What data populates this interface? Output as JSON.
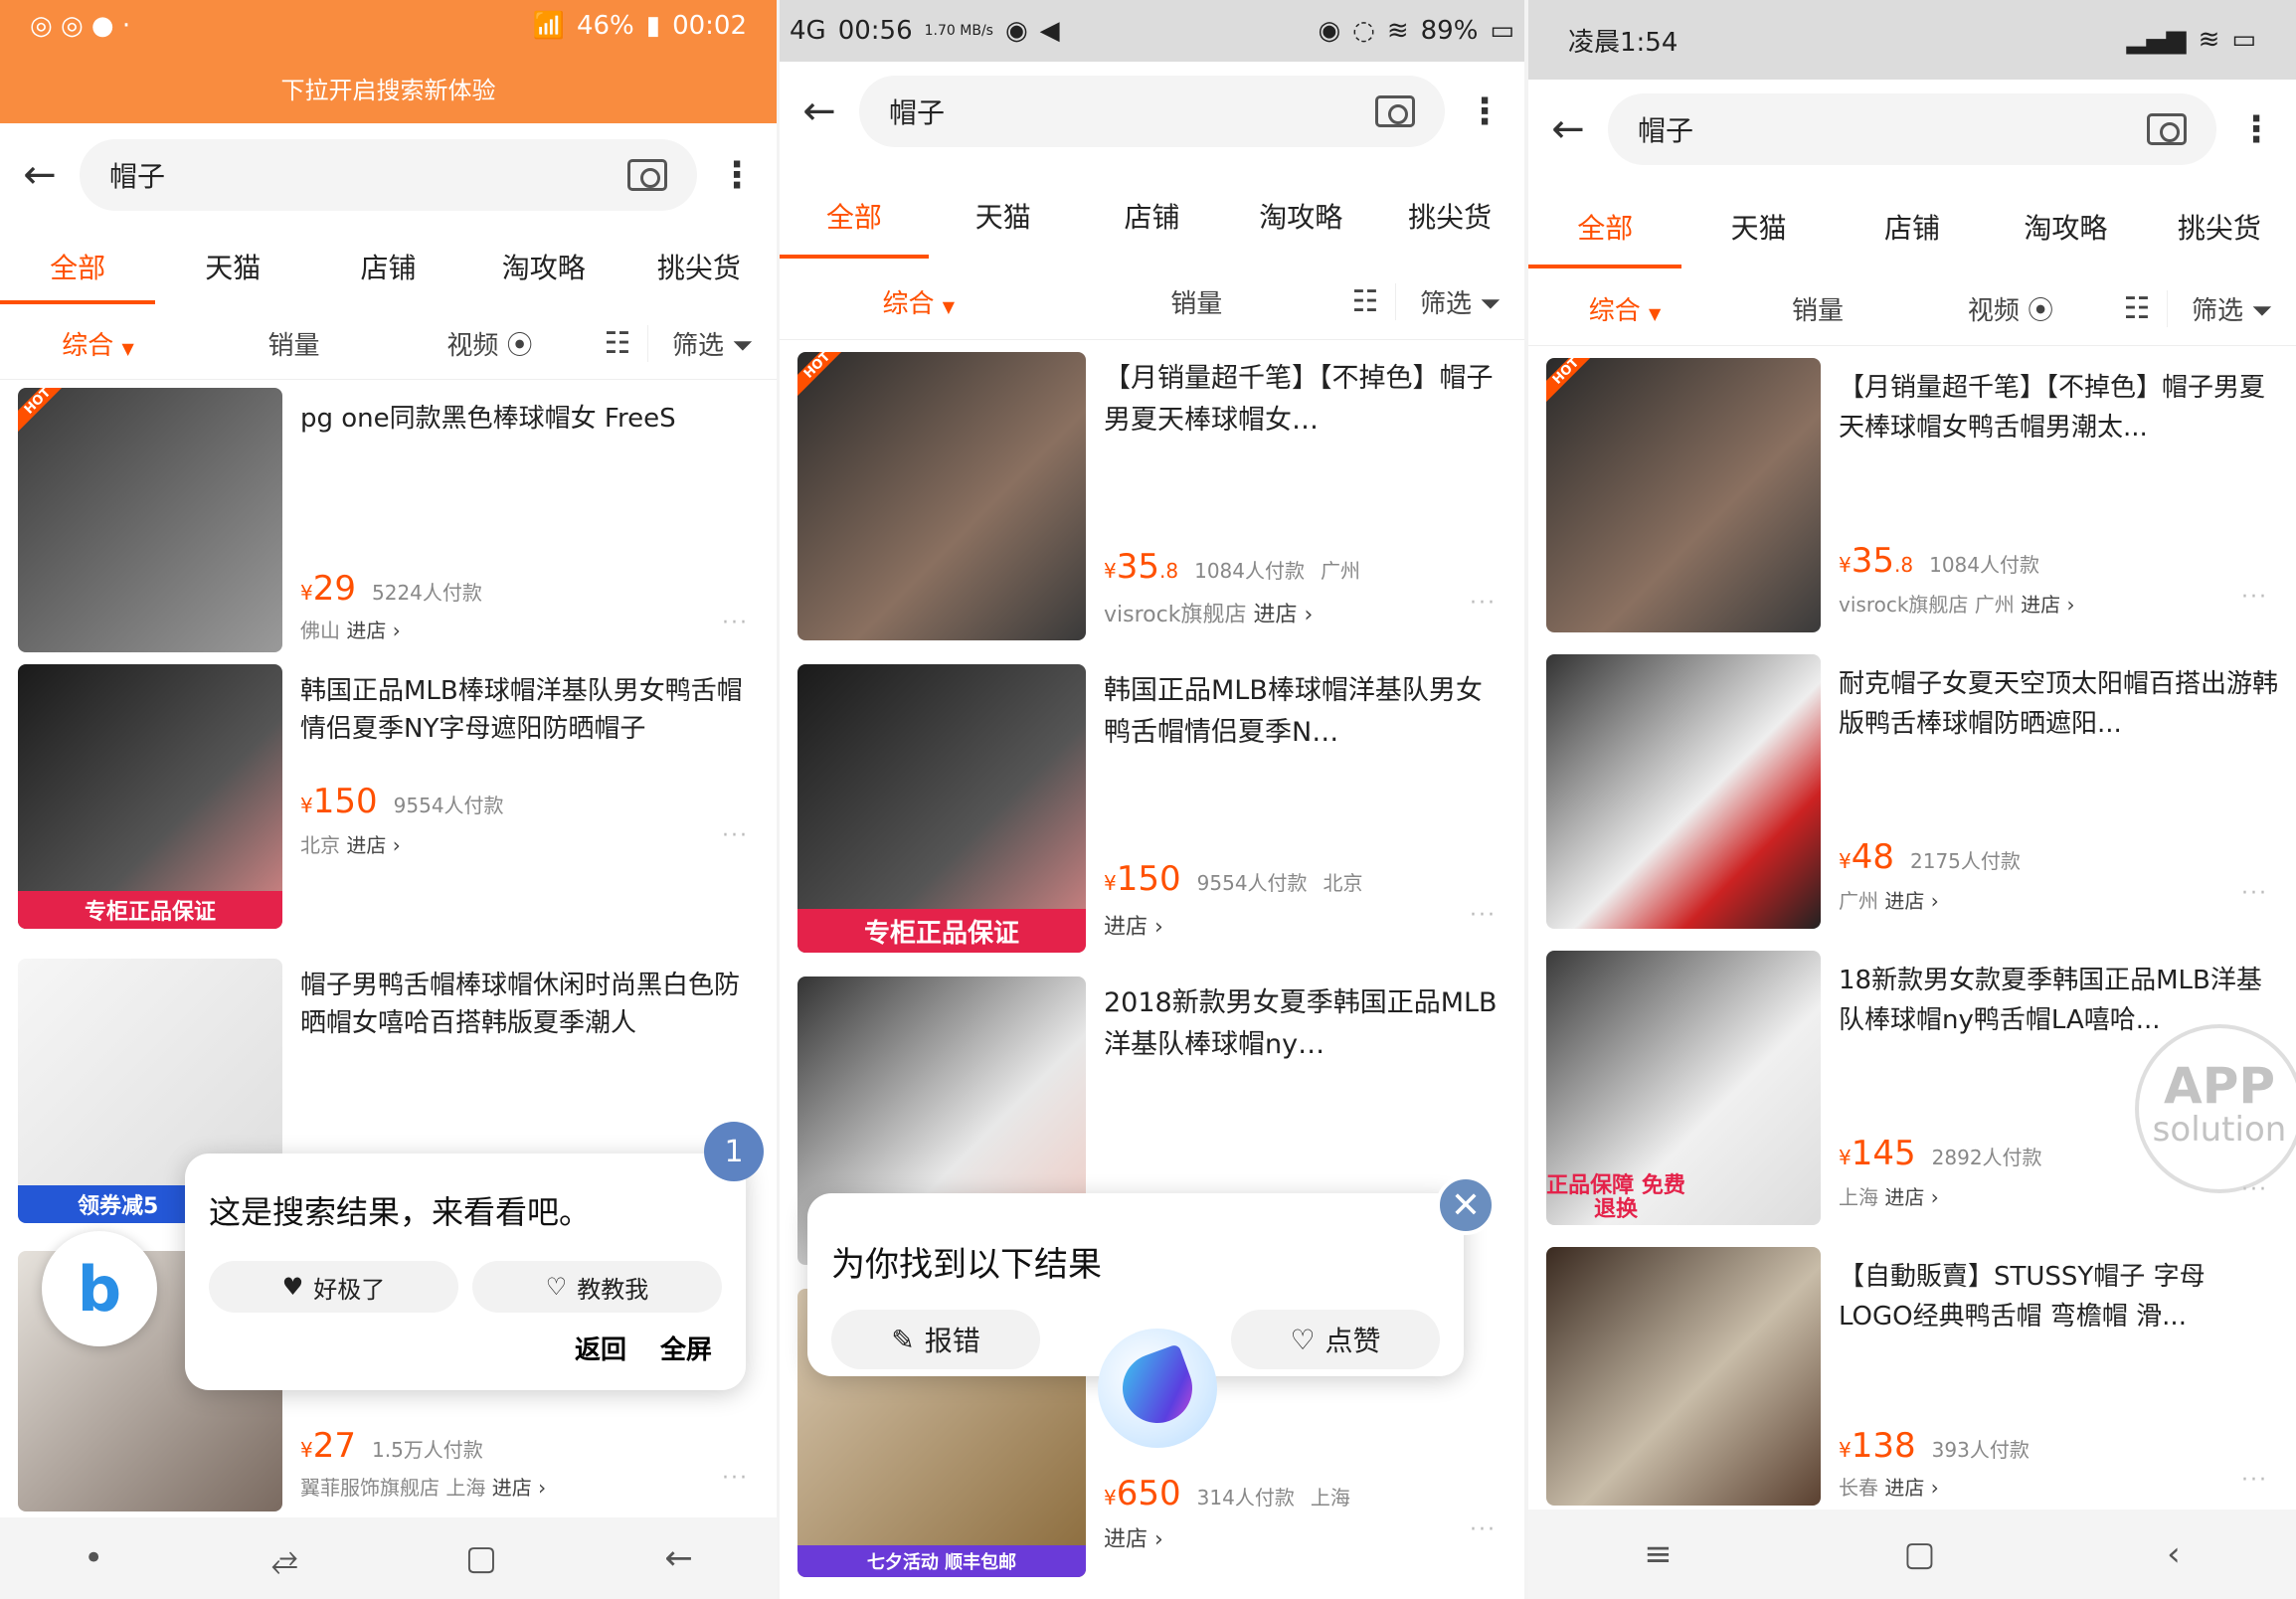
{
  "s1": {
    "status": {
      "battery": "46%",
      "time": "00:02"
    },
    "pulldown": "下拉开启搜索新体验",
    "search": {
      "query": "帽子"
    },
    "tabs": [
      "全部",
      "天猫",
      "店铺",
      "淘攻略",
      "挑尖货"
    ],
    "sort": {
      "comp": "综合",
      "sales": "销量",
      "video": "视频",
      "filter": "筛选"
    },
    "items": [
      {
        "title": "pg one同款黑色棒球帽女 FreeS",
        "price": "29",
        "sales": "5224人付款",
        "shop": "佛山",
        "go": "进店 ›"
      },
      {
        "title": "韩国正品MLB棒球帽洋基队男女鸭舌帽情侣夏季NY字母遮阳防晒帽子",
        "price": "150",
        "sales": "9554人付款",
        "shop": "北京",
        "go": "进店 ›",
        "promo": "专柜正品保证"
      },
      {
        "title": "帽子男鸭舌帽棒球帽休闲时尚黑白色防晒帽女嘻哈百搭韩版夏季潮人",
        "promo": "领券减5"
      },
      {
        "price": "27",
        "sales": "1.5万人付款",
        "shop": "翼菲服饰旗舰店 上海",
        "go": "进店 ›"
      }
    ],
    "card": {
      "msg": "这是搜索结果，来看看吧。",
      "like": "好极了",
      "teach": "教教我",
      "back": "返回",
      "full": "全屏"
    },
    "badge": "1"
  },
  "s2": {
    "status": {
      "net": "4G",
      "time": "00:56",
      "speed": "1.70 MB/s",
      "battery": "89%"
    },
    "search": {
      "query": "帽子"
    },
    "tabs": [
      "全部",
      "天猫",
      "店铺",
      "淘攻略",
      "挑尖货"
    ],
    "sort": {
      "comp": "综合",
      "sales": "销量",
      "filter": "筛选"
    },
    "items": [
      {
        "title": "【月销量超千笔】【不掉色】帽子男夏天棒球帽女…",
        "price": "35",
        "price_dec": ".8",
        "sales": "1084人付款",
        "loc": "广州",
        "shop": "visrock旗舰店",
        "go": "进店 ›"
      },
      {
        "title": "韩国正品MLB棒球帽洋基队男女鸭舌帽情侣夏季N…",
        "price": "150",
        "sales": "9554人付款",
        "loc": "北京",
        "go": "进店 ›",
        "promo": "专柜正品保证"
      },
      {
        "title": "2018新款男女夏季韩国正品MLB洋基队棒球帽ny…"
      },
      {
        "price": "650",
        "sales": "314人付款",
        "loc": "上海",
        "go": "进店 ›",
        "promo": "七夕活动 顺丰包邮"
      }
    ],
    "card": {
      "msg": "为你找到以下结果",
      "report": "报错",
      "like": "点赞"
    }
  },
  "s3": {
    "status": {
      "time": "凌晨1:54"
    },
    "search": {
      "query": "帽子"
    },
    "tabs": [
      "全部",
      "天猫",
      "店铺",
      "淘攻略",
      "挑尖货"
    ],
    "sort": {
      "comp": "综合",
      "sales": "销量",
      "video": "视频",
      "filter": "筛选"
    },
    "items": [
      {
        "title": "【月销量超千笔】【不掉色】帽子男夏天棒球帽女鸭舌帽男潮太...",
        "price": "35",
        "price_dec": ".8",
        "sales": "1084人付款",
        "shop": "visrock旗舰店 广州",
        "go": "进店 ›"
      },
      {
        "title": "耐克帽子女夏天空顶太阳帽百搭出游韩版鸭舌棒球帽防晒遮阳...",
        "price": "48",
        "sales": "2175人付款",
        "shop": "广州",
        "go": "进店 ›"
      },
      {
        "title": "18新款男女款夏季韩国正品MLB洋基队棒球帽ny鸭舌帽LA嘻哈...",
        "price": "145",
        "sales": "2892人付款",
        "shop": "上海",
        "go": "进店 ›",
        "promo": "正品保障 免费退换"
      },
      {
        "title": "【自動販賣】STUSSY帽子 字母LOGO经典鸭舌帽 弯檐帽 滑...",
        "price": "138",
        "sales": "393人付款",
        "shop": "长春",
        "go": "进店 ›"
      }
    ],
    "watermark": {
      "big": "APP",
      "small": "solution"
    }
  },
  "colors": {
    "accent": "#ff5000",
    "orange_bar": "#f98c3f"
  }
}
